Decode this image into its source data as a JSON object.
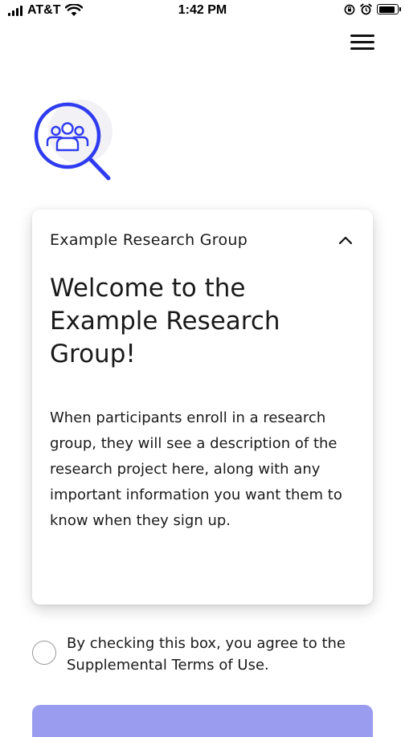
{
  "status_bar": {
    "carrier": "AT&T",
    "time": "1:42 PM",
    "battery_level": 0.9
  },
  "icons": {
    "menu": "hamburger-menu-icon",
    "logo": "magnifier-people-icon",
    "collapse": "chevron-up-icon"
  },
  "colors": {
    "accent": "#2f3bf0",
    "button": "#9a9cf0",
    "logo_circle_bg": "#f1f1f6"
  },
  "card": {
    "group_name": "Example Research Group",
    "title": "Welcome to the Example Research Group!",
    "description": "When participants enroll in a research group, they will see a description of the research project here, along with any important information you want them to know when they sign up."
  },
  "consent": {
    "text": "By checking this box, you agree to the Supplemental Terms of Use.",
    "checked": false
  }
}
